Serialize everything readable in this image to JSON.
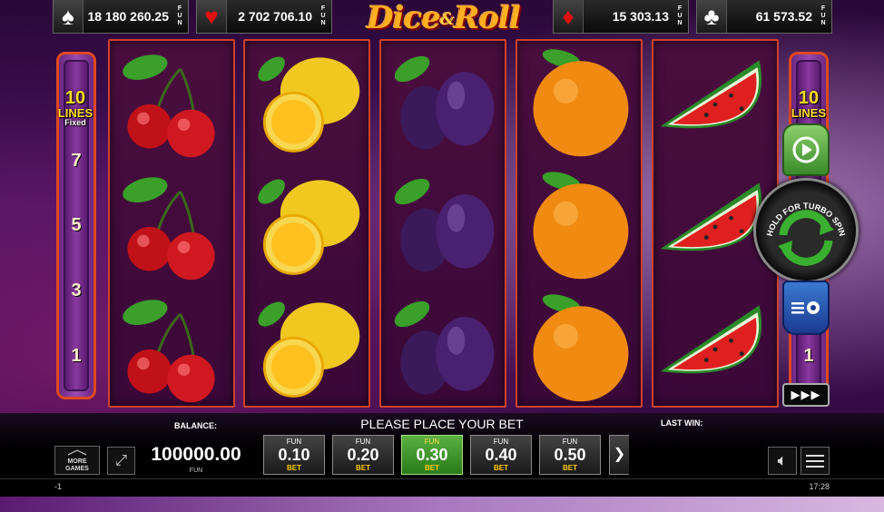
{
  "game": {
    "title": "Dice & Roll"
  },
  "jackpots": [
    {
      "suit": "spade-icon",
      "glyph": "♠",
      "value": "18 180 260.25",
      "currency": "FUN",
      "color": "#ffffff"
    },
    {
      "suit": "heart-icon",
      "glyph": "♥",
      "value": "2 702 706.10",
      "currency": "FUN",
      "color": "#e01010"
    },
    {
      "suit": "diamond-icon",
      "glyph": "♦",
      "value": "15 303.13",
      "currency": "FUN",
      "color": "#e01010"
    },
    {
      "suit": "club-icon",
      "glyph": "♣",
      "value": "61 573.52",
      "currency": "FUN",
      "color": "#ffffff"
    }
  ],
  "left_lines": {
    "count": "10",
    "label": "LINES",
    "fixed": "Fixed",
    "numbers": [
      "7",
      "5",
      "3",
      "1"
    ]
  },
  "right_lines": {
    "count": "10",
    "label": "LINES",
    "numbers": [
      "1"
    ]
  },
  "reels": [
    [
      "cherry",
      "cherry",
      "cherry"
    ],
    [
      "lemon",
      "lemon",
      "lemon"
    ],
    [
      "plum",
      "plum",
      "plum"
    ],
    [
      "orange",
      "orange",
      "orange"
    ],
    [
      "watermelon",
      "watermelon",
      "watermelon"
    ]
  ],
  "controls": {
    "spin_hint": "HOLD FOR TURBO SPIN",
    "turbo_label": "▶▶▶"
  },
  "bottom": {
    "balance_label": "BALANCE:",
    "balance_value": "100000.00",
    "balance_currency": "FUN",
    "message": "PLEASE PLACE YOUR BET",
    "last_win_label": "LAST WIN:",
    "more_games_label": "MORE GAMES",
    "bets": [
      {
        "fun": "FUN",
        "value": "0.10",
        "label": "BET",
        "selected": false
      },
      {
        "fun": "FUN",
        "value": "0.20",
        "label": "BET",
        "selected": false
      },
      {
        "fun": "FUN",
        "value": "0.30",
        "label": "BET",
        "selected": true
      },
      {
        "fun": "FUN",
        "value": "0.40",
        "label": "BET",
        "selected": false
      },
      {
        "fun": "FUN",
        "value": "0.50",
        "label": "BET",
        "selected": false
      }
    ]
  },
  "status": {
    "left": "-1",
    "time": "17:28"
  }
}
